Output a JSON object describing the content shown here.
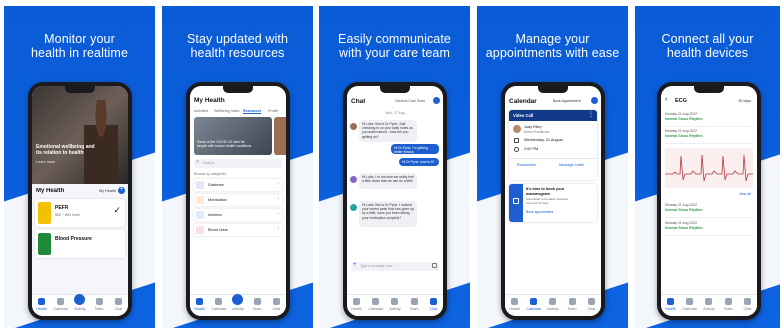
{
  "panels": [
    {
      "caption": "Monitor your\nhealth in realtime",
      "hero_title": "Emotional wellbeing and\nits relation to health",
      "hero_link": "Learn more",
      "section_title": "My Health",
      "section_link": "My Health",
      "metric1": {
        "name": "PEFR",
        "value": "500 ~ 800 l/min"
      },
      "metric2": {
        "name": "Blood Pressure"
      },
      "tabs": [
        "Health",
        "Calendar",
        "Activity",
        "Team",
        "Chat"
      ],
      "active_tab": "Health"
    },
    {
      "caption": "Stay updated with\nhealth resources",
      "title": "My Health",
      "subtabs": [
        "Activities",
        "Wellbeing Index",
        "Resources",
        "Profile"
      ],
      "active_subtab": "Resources",
      "banner": "Some of the COVID-19 risks for\npeople with known health conditions",
      "search_placeholder": "Search",
      "browse_label": "Browse by categories",
      "categories": [
        "Diabetes",
        "Medication",
        "Asthma",
        "Blood tests"
      ],
      "tabs": [
        "Health",
        "Calendar",
        "Activity",
        "Team",
        "Chat"
      ],
      "active_tab": "Health"
    },
    {
      "caption": "Easily communicate\nwith your care team",
      "title": "Chat",
      "team_label": "Genesis Care Team",
      "day": "Mon, 27 Aug",
      "messages": [
        {
          "dir": "in",
          "text": "Hi Luke, this is Dr Pyne. Just checking in on your daily notes as you asked about - how are you getting on?"
        },
        {
          "dir": "out",
          "text": "Hi Dr Pyne, I'm getting better thanks"
        },
        {
          "dir": "out",
          "text": "Hi Dr Pyne, how is it?"
        },
        {
          "dir": "in",
          "text": "Hi Luke, I'm not sure we really feel a little down that we can do a little"
        },
        {
          "dir": "in",
          "text": "Hi Luke, this is Dr Pyne. I noticed your recent peak flow has gone up by a little, have you been taking your medication properly?"
        }
      ],
      "input_placeholder": "Type a message here",
      "tabs": [
        "Health",
        "Calendar",
        "Activity",
        "Team",
        "Chat"
      ],
      "active_tab": "Chat"
    },
    {
      "caption": "Manage your\nappointments with ease",
      "title": "Calendar",
      "book_label": "Book Appointment",
      "card_title": "Video Call",
      "doctor": "Judy Riley",
      "doctor_role": "Nurse Practitioner",
      "date": "Wednesday, 21 August",
      "time": "2:00 PM",
      "btn_reschedule": "Reschedule",
      "btn_message": "Message Leslie",
      "notice_title": "It's time to book your\nmammogram",
      "notice_body": "Scheduled to be taken between\nnow and 12 Sept",
      "notice_link": "Book appointment",
      "tabs": [
        "Health",
        "Calendar",
        "Activity",
        "Team",
        "Chat"
      ],
      "active_tab": "Calendar"
    },
    {
      "caption": "Connect all your\nhealth devices",
      "title": "ECG",
      "filter": "30 days",
      "readings": [
        {
          "date": "Monday 21 Aug 2022",
          "status": "Normal Sinus Rhythm"
        },
        {
          "date": "Monday 21 Aug 2022",
          "status": "Normal Sinus Rhythm"
        },
        {
          "date": "Monday 21 Aug 2022",
          "status": "Normal Sinus Rhythm"
        },
        {
          "date": "Monday 21 Aug 2022",
          "status": "Normal Sinus Rhythm"
        }
      ],
      "view_all": "View all",
      "tabs": [
        "Health",
        "Calendar",
        "Activity",
        "Team",
        "Chat"
      ],
      "active_tab": "Health"
    }
  ],
  "colors": {
    "panel_blue": "#0b5fdc",
    "accent_blue": "#1d5fd1",
    "pefr_yellow": "#f2c200",
    "bp_green": "#1f8a3a",
    "status_green": "#2a9a4a"
  }
}
